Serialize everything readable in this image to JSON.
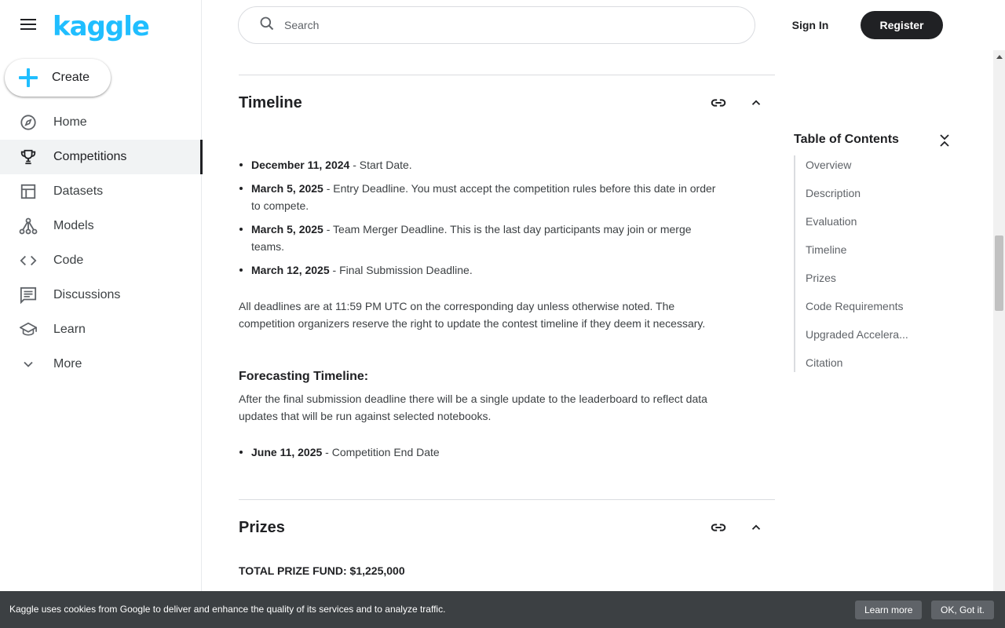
{
  "brand": {
    "logo_text": "kaggle",
    "accent": "#20beff"
  },
  "create": {
    "label": "Create"
  },
  "nav": {
    "items": [
      {
        "label": "Home",
        "icon": "compass-icon"
      },
      {
        "label": "Competitions",
        "icon": "trophy-icon",
        "active": true
      },
      {
        "label": "Datasets",
        "icon": "table-icon"
      },
      {
        "label": "Models",
        "icon": "models-icon"
      },
      {
        "label": "Code",
        "icon": "code-icon"
      },
      {
        "label": "Discussions",
        "icon": "discussion-icon"
      },
      {
        "label": "Learn",
        "icon": "graduation-cap-icon"
      },
      {
        "label": "More",
        "icon": "chevron-down-icon"
      }
    ]
  },
  "header": {
    "search_placeholder": "Search",
    "signin_label": "Sign In",
    "register_label": "Register"
  },
  "timeline": {
    "title": "Timeline",
    "items": [
      {
        "date": "December 11, 2024",
        "text": " - Start Date."
      },
      {
        "date": "March 5, 2025",
        "text": " - Entry Deadline. You must accept the competition rules before this date in order to compete."
      },
      {
        "date": "March 5, 2025",
        "text": " - Team Merger Deadline. This is the last day participants may join or merge teams."
      },
      {
        "date": "March 12, 2025",
        "text": " - Final Submission Deadline."
      }
    ],
    "note": "All deadlines are at 11:59 PM UTC on the corresponding day unless otherwise noted. The competition organizers reserve the right to update the contest timeline if they deem it necessary.",
    "forecasting_title": "Forecasting Timeline:",
    "forecasting_text": "After the final submission deadline there will be a single update to the leaderboard to reflect data updates that will be run against selected notebooks.",
    "forecasting_items": [
      {
        "date": "June 11, 2025",
        "text": " - Competition End Date"
      }
    ]
  },
  "prizes": {
    "title": "Prizes",
    "total": "TOTAL PRIZE FUND: $1,225,000"
  },
  "toc": {
    "title": "Table of Contents",
    "items": [
      "Overview",
      "Description",
      "Evaluation",
      "Timeline",
      "Prizes",
      "Code Requirements",
      "Upgraded Accelera...",
      "Citation"
    ]
  },
  "cookie": {
    "text": "Kaggle uses cookies from Google to deliver and enhance the quality of its services and to analyze traffic.",
    "learn_more": "Learn more",
    "ok": "OK, Got it."
  }
}
